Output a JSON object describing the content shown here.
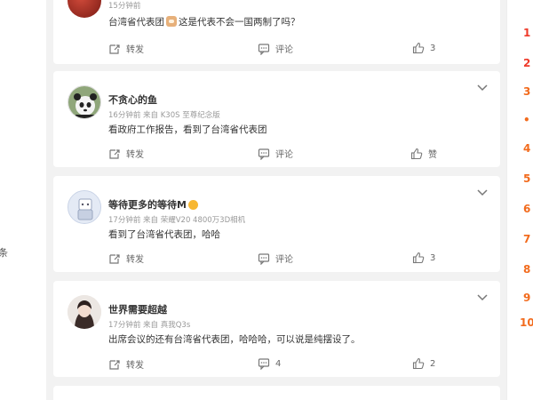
{
  "left_panel": {
    "char": "条"
  },
  "right_panel": {
    "ranks": [
      "1",
      "2",
      "3",
      "•",
      "4",
      "5",
      "6",
      "7",
      "8",
      "9",
      "10"
    ]
  },
  "colors": {
    "accent": "#f26b1d",
    "rank_red": "#ef3a2a",
    "background": "#f2f2f2",
    "card": "#ffffff"
  },
  "comments": [
    {
      "avatar_icon": "avatar-red-image",
      "username": "",
      "time": "15分钟前",
      "text_before": "台湾省代表团",
      "emoji_icon": "doge-emoji-icon",
      "text_after": "这是代表不会一国两制了吗？",
      "repost_label": "转发",
      "comment_label": "评论",
      "like_count": "3"
    },
    {
      "avatar_icon": "panda-avatar",
      "username": "不贪心的鱼",
      "meta": "16分钟前  来自 K30S 至尊纪念版",
      "text": "看政府工作报告，看到了台湾省代表团",
      "repost_label": "转发",
      "comment_label": "评论",
      "like_label": "赞"
    },
    {
      "avatar_icon": "cartoon-avatar",
      "username": "等待更多的等待M",
      "verified_icon": "gold-vip-badge-icon",
      "meta": "17分钟前  来自 荣耀V20 4800万3D相机",
      "text": "看到了台湾省代表团，哈哈",
      "repost_label": "转发",
      "comment_label": "评论",
      "like_count": "3"
    },
    {
      "avatar_icon": "girl-avatar",
      "username": "世界需要超越",
      "meta": "17分钟前  来自 真我Q3s",
      "text": "出席会议的还有台湾省代表团，哈哈哈，可以说是纯摆设了。",
      "repost_label": "转发",
      "comment_count": "4",
      "like_count": "2"
    }
  ]
}
